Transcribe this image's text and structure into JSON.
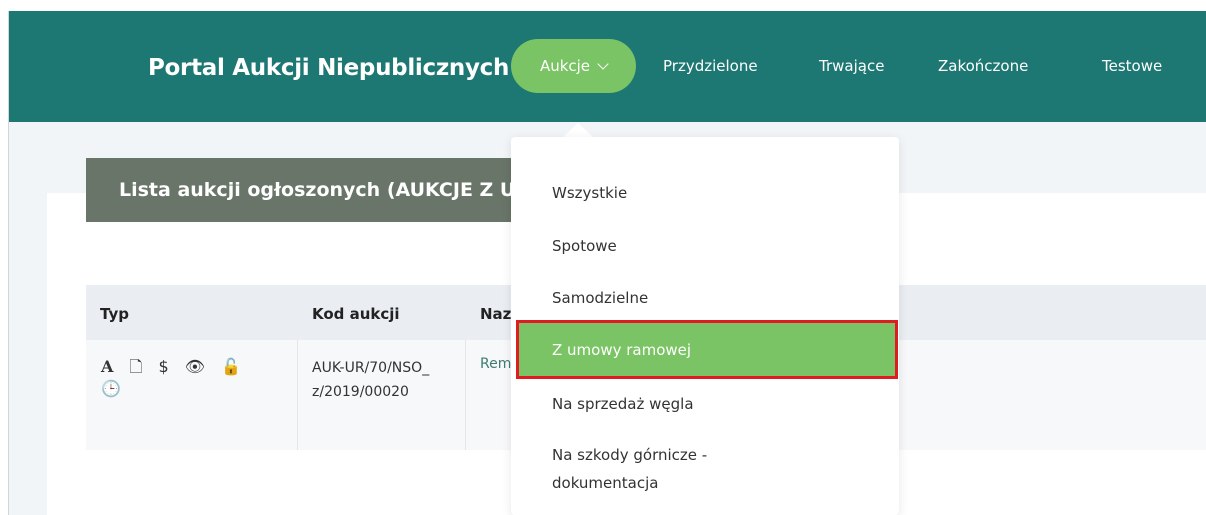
{
  "header": {
    "brand": "Portal Aukcji Niepublicznych",
    "nav": {
      "active_label": "Aukcje",
      "items": [
        "Przydzielone",
        "Trwające",
        "Zakończone",
        "Testowe"
      ]
    }
  },
  "main": {
    "title": "Lista aukcji ogłoszonych (AUKCJE Z U",
    "table": {
      "headers": [
        "Typ",
        "Kod aukcji",
        "Naz"
      ],
      "row": {
        "type_icons": [
          "A",
          "🗋",
          "$",
          "👁",
          "🔓",
          "🕒"
        ],
        "code": "AUK-UR/70/NSO_z/2019/00020",
        "name": "Rem"
      }
    }
  },
  "dropdown": {
    "items": [
      "Wszystkie",
      "Spotowe",
      "Samodzielne",
      "Z umowy ramowej",
      "Na sprzedaż węgla",
      "Na szkody górnicze - dokumentacja"
    ],
    "active_index": 3
  },
  "colors": {
    "header_bg": "#1d7772",
    "accent_green": "#7ac465",
    "title_banner": "#687568",
    "highlight_border": "#e01b22"
  }
}
